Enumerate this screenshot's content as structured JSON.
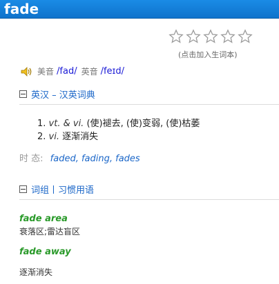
{
  "header": {
    "word": "fade"
  },
  "rating": {
    "stars": 5,
    "filled": 0,
    "add_label": "(点击加入生词本)"
  },
  "pronunciation": {
    "us_label": "美音",
    "us_phonetic": "/fad/",
    "uk_label": "英音",
    "uk_phonetic": "/feɪd/"
  },
  "dictionary": {
    "title": "英汉 – 汉英词典",
    "definitions": [
      {
        "num": "1.",
        "pos": "vt. & vi.",
        "meaning": "(使)褪去, (使)变弱, (使)枯萎"
      },
      {
        "num": "2.",
        "pos": "vi.",
        "meaning": "逐渐消失"
      }
    ],
    "tense_label": "时 态:",
    "tense_forms": "faded, fading, fades"
  },
  "phrases": {
    "title": "词组丨习惯用语",
    "items": [
      {
        "term": "fade area",
        "meaning": "衰落区;雷达盲区"
      },
      {
        "term": "fade away",
        "meaning": "逐渐消失"
      }
    ]
  }
}
